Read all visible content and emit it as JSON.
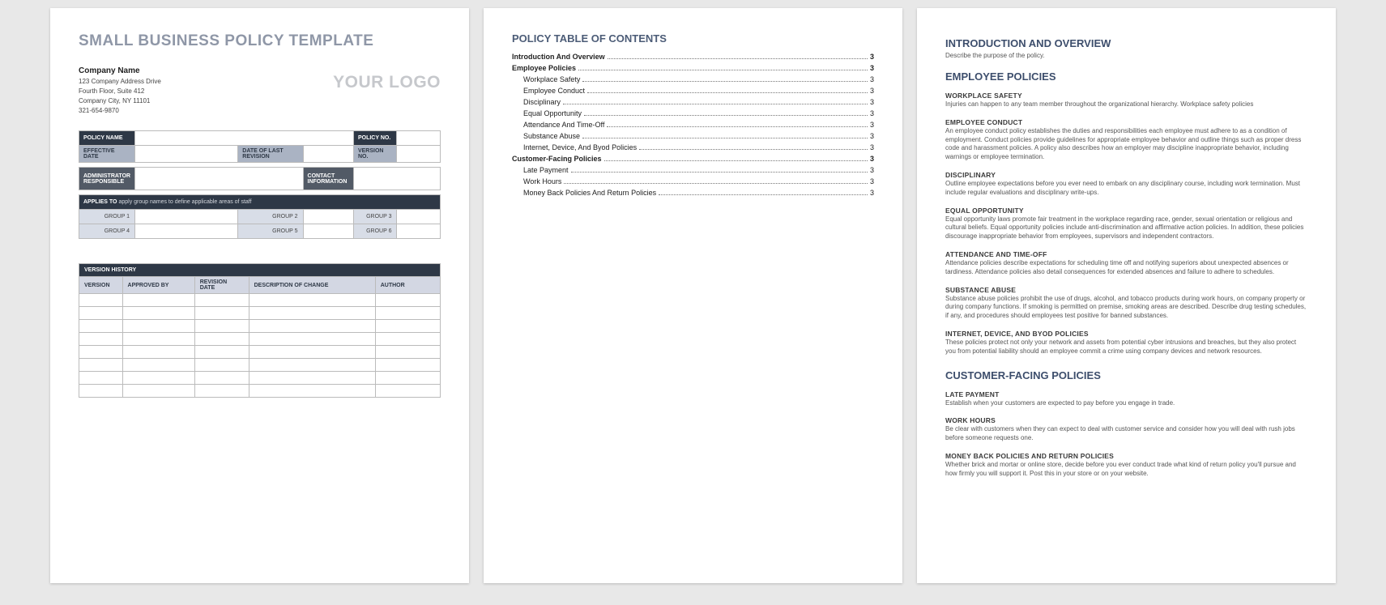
{
  "page1": {
    "title": "SMALL BUSINESS POLICY TEMPLATE",
    "company": {
      "name": "Company Name",
      "addr1": "123 Company Address Drive",
      "addr2": "Fourth Floor, Suite 412",
      "addr3": "Company City, NY  11101",
      "phone": "321-654-9870"
    },
    "logo": "YOUR LOGO",
    "labels": {
      "policy_name": "POLICY NAME",
      "policy_no": "POLICY NO.",
      "eff_date": "EFFECTIVE DATE",
      "last_rev": "DATE OF LAST REVISION",
      "ver_no": "VERSION NO.",
      "admin": "ADMINISTRATOR RESPONSIBLE",
      "contact": "CONTACT INFORMATION",
      "applies": "APPLIES TO",
      "applies_note": "apply group names to define applicable areas of staff",
      "g1": "GROUP 1",
      "g2": "GROUP 2",
      "g3": "GROUP 3",
      "g4": "GROUP 4",
      "g5": "GROUP 5",
      "g6": "GROUP 6",
      "vh": "VERSION HISTORY",
      "col_version": "VERSION",
      "col_approved": "APPROVED BY",
      "col_revdate": "REVISION DATE",
      "col_desc": "DESCRIPTION OF CHANGE",
      "col_author": "AUTHOR"
    }
  },
  "page2": {
    "title": "POLICY TABLE OF CONTENTS",
    "entries": [
      {
        "text": "Introduction And Overview",
        "page": "3",
        "bold": true,
        "sub": false
      },
      {
        "text": "Employee Policies",
        "page": "3",
        "bold": true,
        "sub": false
      },
      {
        "text": "Workplace Safety",
        "page": "3",
        "bold": false,
        "sub": true
      },
      {
        "text": "Employee Conduct",
        "page": "3",
        "bold": false,
        "sub": true
      },
      {
        "text": "Disciplinary",
        "page": "3",
        "bold": false,
        "sub": true
      },
      {
        "text": "Equal Opportunity",
        "page": "3",
        "bold": false,
        "sub": true
      },
      {
        "text": "Attendance And Time-Off",
        "page": "3",
        "bold": false,
        "sub": true
      },
      {
        "text": "Substance Abuse",
        "page": "3",
        "bold": false,
        "sub": true
      },
      {
        "text": "Internet, Device, And Byod Policies",
        "page": "3",
        "bold": false,
        "sub": true
      },
      {
        "text": "Customer-Facing Policies",
        "page": "3",
        "bold": true,
        "sub": false
      },
      {
        "text": "Late Payment",
        "page": "3",
        "bold": false,
        "sub": true
      },
      {
        "text": "Work Hours",
        "page": "3",
        "bold": false,
        "sub": true
      },
      {
        "text": "Money Back Policies And Return Policies",
        "page": "3",
        "bold": false,
        "sub": true
      }
    ]
  },
  "page3": {
    "h_intro": "INTRODUCTION AND OVERVIEW",
    "intro_sub": "Describe the purpose of the policy.",
    "h_emp": "EMPLOYEE POLICIES",
    "emp": [
      {
        "h": "WORKPLACE SAFETY",
        "b": "Injuries can happen to any team member throughout the organizational hierarchy. Workplace safety policies"
      },
      {
        "h": "EMPLOYEE CONDUCT",
        "b": "An employee conduct policy establishes the duties and responsibilities each employee must adhere to as a condition of employment. Conduct policies provide guidelines for appropriate employee behavior and outline things such as proper dress code and harassment policies. A policy also describes how an employer may discipline inappropriate behavior, including warnings or employee termination."
      },
      {
        "h": "DISCIPLINARY",
        "b": "Outline employee expectations before you ever need to embark on any disciplinary course, including work termination. Must include regular evaluations and disciplinary write-ups."
      },
      {
        "h": "EQUAL OPPORTUNITY",
        "b": "Equal opportunity laws promote fair treatment in the workplace regarding race, gender, sexual orientation or religious and cultural beliefs. Equal opportunity policies include anti-discrimination and affirmative action policies. In addition, these policies discourage inappropriate behavior from employees, supervisors and independent contractors."
      },
      {
        "h": "ATTENDANCE AND TIME-OFF",
        "b": "Attendance policies describe expectations for scheduling time off and notifying superiors about unexpected absences or tardiness. Attendance policies also detail consequences for extended absences and failure to adhere to schedules."
      },
      {
        "h": "SUBSTANCE ABUSE",
        "b": "Substance abuse policies prohibit the use of drugs, alcohol, and tobacco products during work hours, on company property or during company functions. If smoking is permitted on premise, smoking areas are described. Describe drug testing schedules, if any, and procedures should employees test positive for banned substances."
      },
      {
        "h": "INTERNET, DEVICE, AND BYOD POLICIES",
        "b": "These policies protect not only your network and assets from potential cyber intrusions and breaches, but they also protect you from potential liability should an employee commit a crime using company devices and network resources."
      }
    ],
    "h_cust": "CUSTOMER-FACING POLICIES",
    "cust": [
      {
        "h": "LATE PAYMENT",
        "b": "Establish when your customers are expected to pay before you engage in trade."
      },
      {
        "h": "WORK HOURS",
        "b": "Be clear with customers when they can expect to deal with customer service and consider how you will deal with rush jobs before someone requests one."
      },
      {
        "h": "MONEY BACK POLICIES AND RETURN POLICIES",
        "b": "Whether brick and mortar or online store, decide before you ever conduct trade what kind of return policy you'll pursue and how firmly you will support it. Post this in your store or on your website."
      }
    ]
  }
}
